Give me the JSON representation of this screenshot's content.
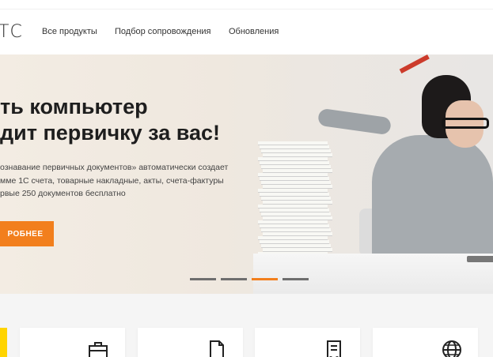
{
  "header": {
    "logo_text": "ТС",
    "nav": [
      {
        "label": "Все продукты"
      },
      {
        "label": "Подбор сопровождения"
      },
      {
        "label": "Обновления"
      }
    ]
  },
  "hero": {
    "title": "ть компьютер\nдит первичку за вас!",
    "description": "ознавание первичных документов» автоматически создает\nмме 1С счета, товарные накладные, акты, счета-фактуры\nрвые 250 документов бесплатно",
    "button_label": "РОБНЕЕ",
    "slides": 4,
    "active_slide": 3
  },
  "cards": [
    {
      "icon": "briefcase-icon"
    },
    {
      "icon": "document-icon"
    },
    {
      "icon": "receipt-icon"
    },
    {
      "icon": "globe-icon"
    }
  ],
  "colors": {
    "accent": "#f27f1d",
    "yellow": "#ffd400"
  }
}
